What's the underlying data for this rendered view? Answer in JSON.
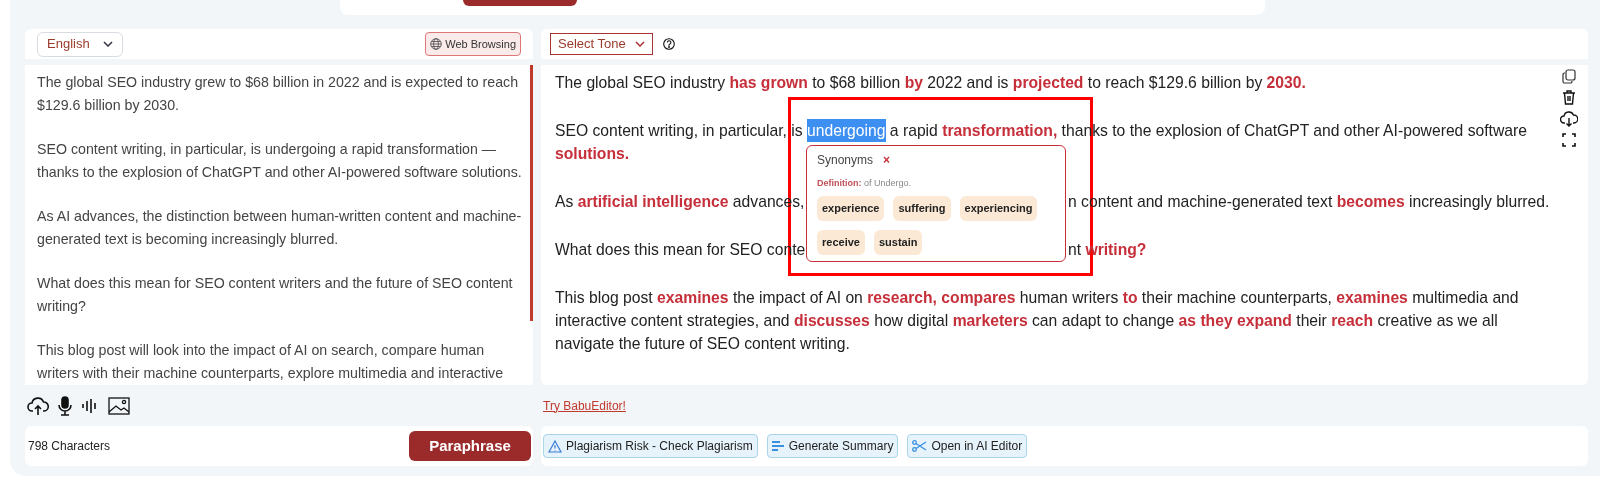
{
  "input_panel": {
    "language": "English",
    "web_browsing": "Web Browsing",
    "paragraphs": [
      "The global SEO industry grew to $68 billion in 2022 and is expected to reach $129.6 billion by 2030.",
      "SEO content writing, in particular, is undergoing a rapid transformation — thanks to the explosion of ChatGPT and other AI-powered software solutions.",
      "As AI advances, the distinction between human-written content and machine-generated text is becoming increasingly blurred.",
      "What does this mean for SEO content writers and the future of SEO content writing?",
      "This blog post will look into the impact of AI on search, compare human writers with their machine counterparts, explore multimedia and interactive"
    ],
    "character_count": "798 Characters",
    "paraphrase_button": "Paraphrase"
  },
  "output_panel": {
    "tone_select": "Select Tone",
    "paragraphs": [
      {
        "occluded": false,
        "runs": [
          {
            "kind": "plain",
            "text": "The global SEO industry **has grown** to $68 billion **by** 2022 and is **projected** to reach $129.6 billion by **2030.**"
          }
        ]
      },
      {
        "occluded": false,
        "runs": [
          {
            "kind": "plain",
            "text": "SEO content writing, in particular, is "
          },
          {
            "kind": "selected",
            "text": "undergoing"
          },
          {
            "kind": "plain",
            "text": " a rapid **transformation,** thanks to the explosion of ChatGPT and other AI-powered software"
          },
          {
            "kind": "continued",
            "text": "**solutions.**"
          }
        ]
      },
      {
        "occluded": true,
        "runs": [
          {
            "kind": "plain",
            "text": "As **artificial intelligence** advances,"
          },
          {
            "kind": "plain",
            "text": "n content and machine-generated text **becomes** increasingly blurred."
          }
        ]
      },
      {
        "occluded": true,
        "runs": [
          {
            "kind": "plain",
            "text": "What does this mean for SEO conte"
          },
          {
            "kind": "plain",
            "text": "nt **writing?**"
          }
        ]
      },
      {
        "occluded": false,
        "runs": [
          {
            "kind": "plain",
            "text": "This blog post **examines** the impact of AI on **research, compares** human writers **to** their machine counterparts, **examines** multimedia and interactive content strategies, and **discusses** how digital **marketers** can adapt to change **as they expand** their **reach** creative as we all navigate the future of SEO content writing."
          }
        ]
      }
    ],
    "synonyms_popup": {
      "title": "Synonyms",
      "close": "×",
      "definition": "**Definition:** of Undergo.",
      "synonyms": [
        "experience",
        "suffering",
        "experiencing",
        "receive",
        "sustain"
      ]
    },
    "try_link": "Try BabuEditor!",
    "actions": [
      {
        "kind": "warning",
        "label": "Plagiarism Risk - Check Plagiarism"
      },
      {
        "kind": "summary",
        "label": "Generate Summary"
      },
      {
        "kind": "editor",
        "label": "Open in AI Editor"
      }
    ]
  }
}
